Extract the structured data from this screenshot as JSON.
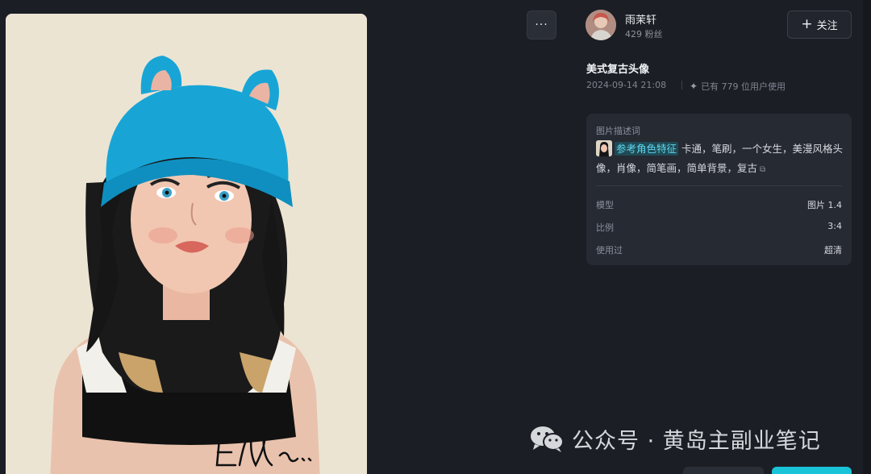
{
  "author": {
    "name": "雨茉轩",
    "fans": "429 粉丝"
  },
  "more_label": "···",
  "follow_label": "关注",
  "work": {
    "title": "美式复古头像",
    "date": "2024-09-14 21:08",
    "usage": "已有 779 位用户使用"
  },
  "prompt": {
    "label": "图片描述词",
    "ref_tag": "参考角色特征",
    "text": "卡通，笔刷，一个女生，美漫风格头像，肖像，简笔画，简单背景，复古"
  },
  "params": [
    {
      "key": "模型",
      "value": "图片 1.4"
    },
    {
      "key": "比例",
      "value": "3:4"
    },
    {
      "key": "使用过",
      "value": "超清"
    }
  ],
  "watermark": "公众号 · 黄岛主副业笔记",
  "signature": "Ella..",
  "colors": {
    "accent": "#19c3d8",
    "background": "#1b1e25",
    "card": "#262a33"
  }
}
